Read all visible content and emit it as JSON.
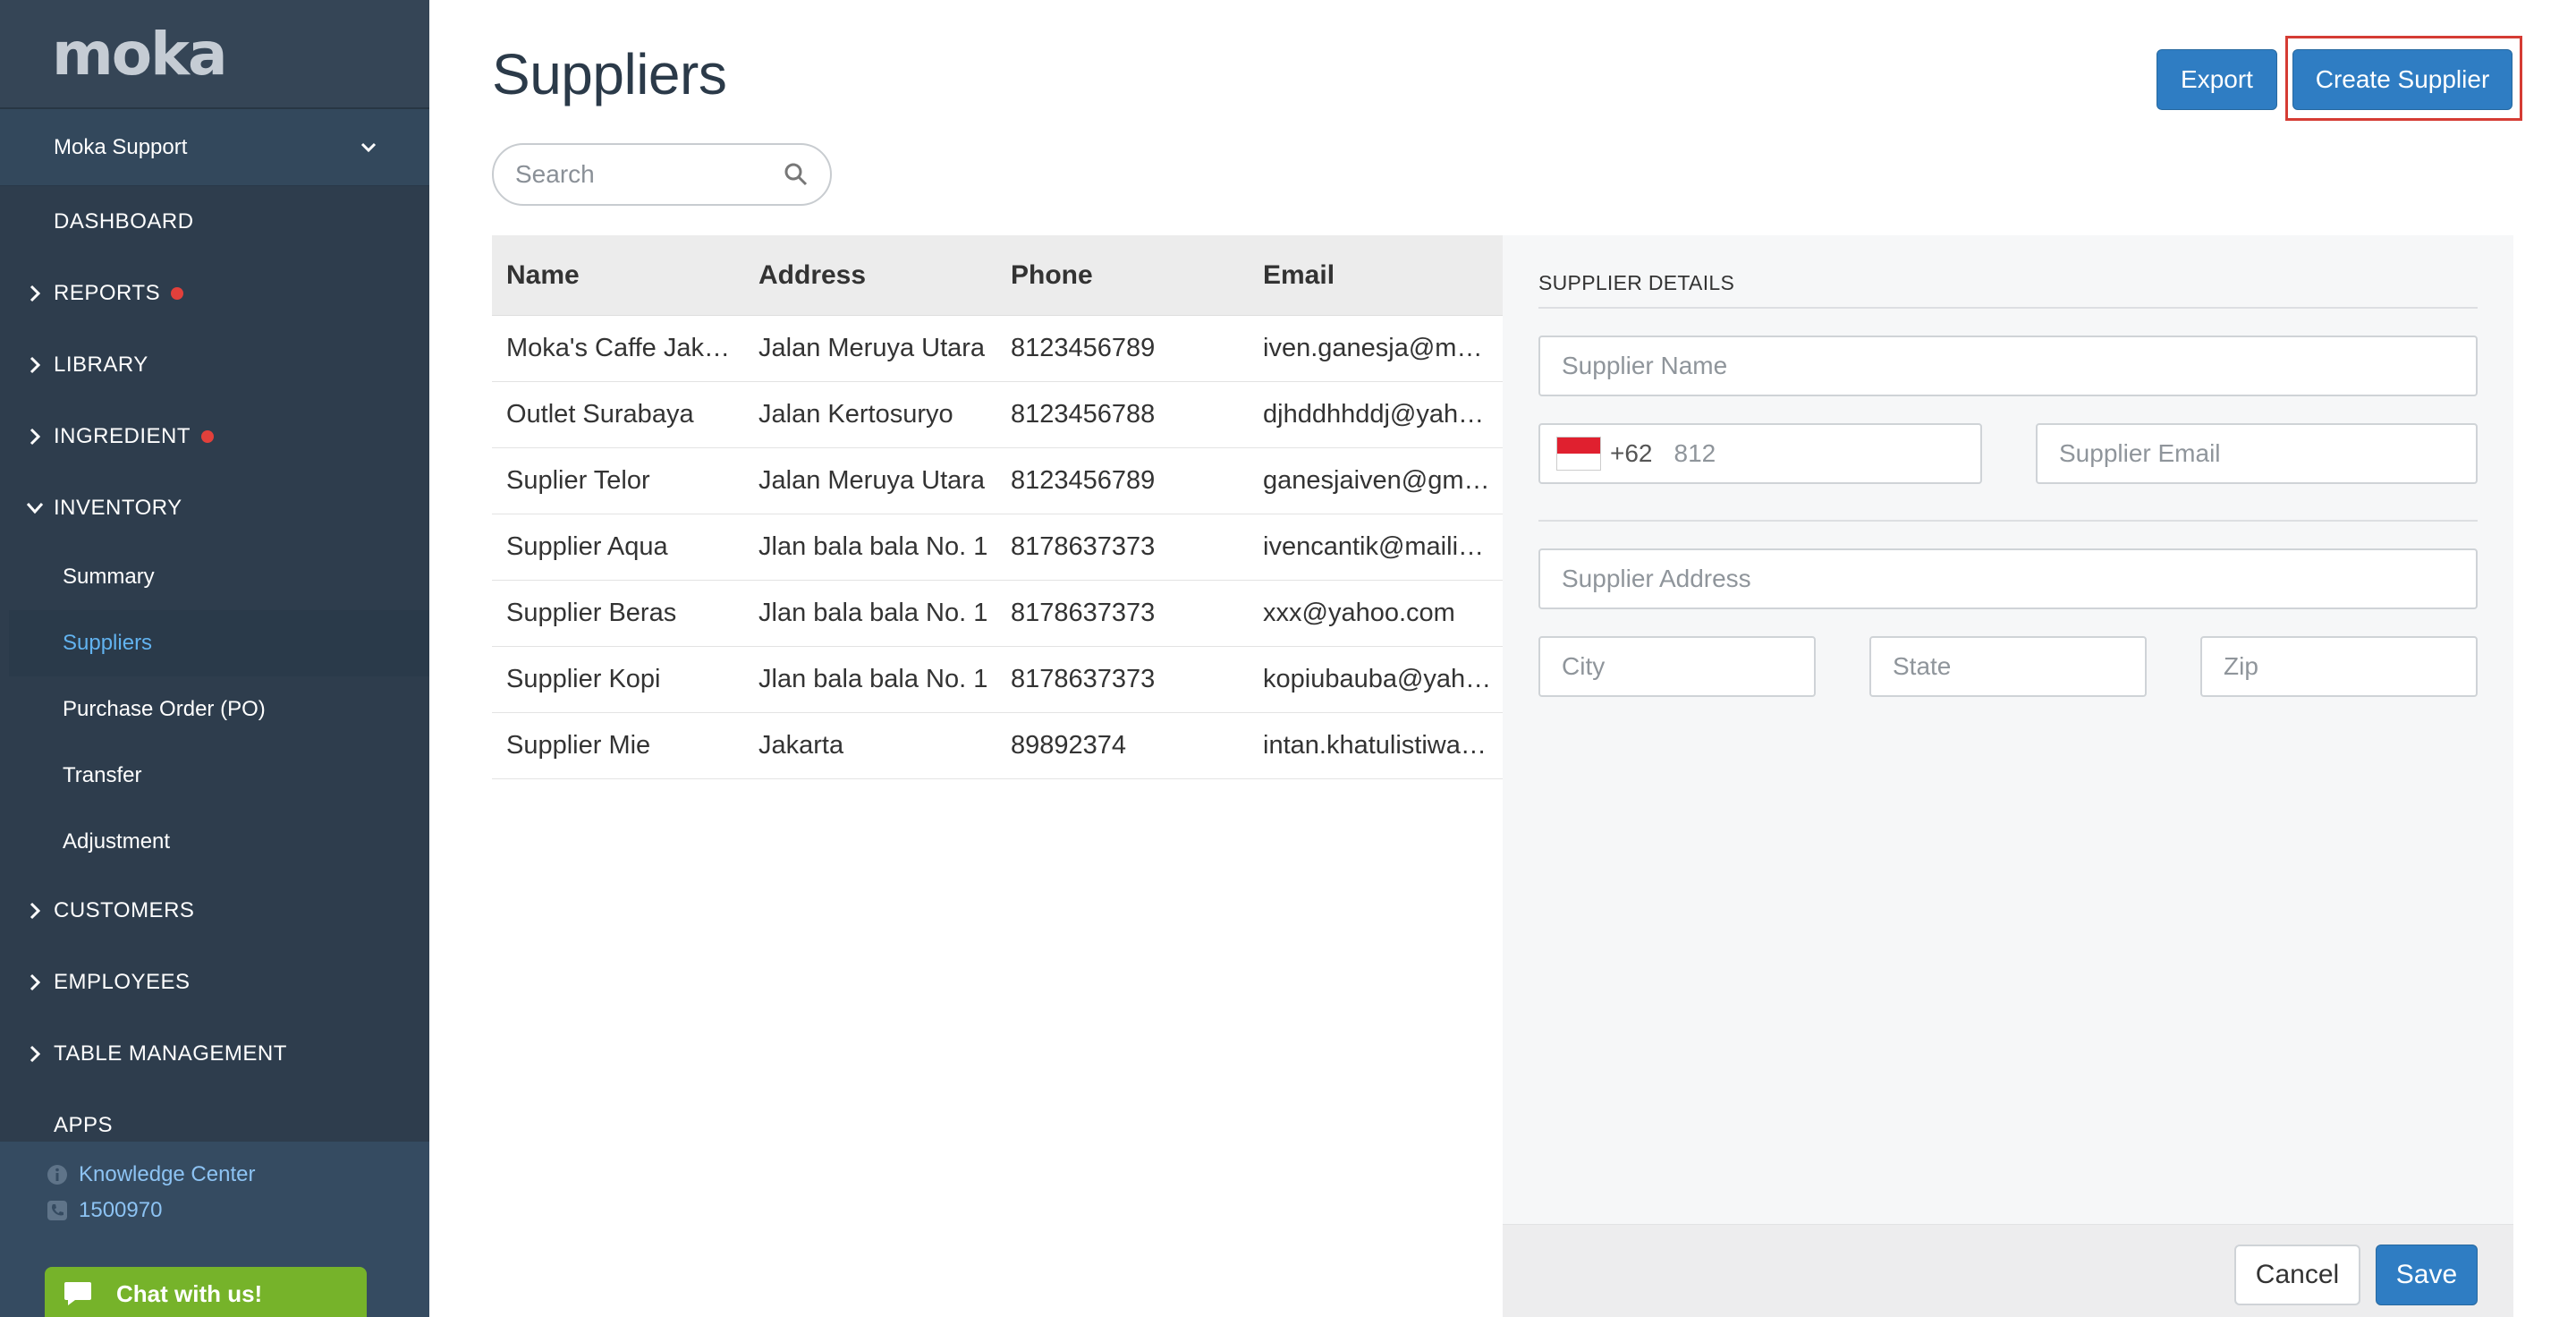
{
  "sidebar": {
    "logo": "moka",
    "account": "Moka Support",
    "nav": {
      "dashboard": "DASHBOARD",
      "reports": "REPORTS",
      "library": "LIBRARY",
      "ingredient": "INGREDIENT",
      "inventory": "INVENTORY",
      "customers": "CUSTOMERS",
      "employees": "EMPLOYEES",
      "table_management": "TABLE MANAGEMENT",
      "apps": "APPS"
    },
    "inventory_sub": {
      "summary": "Summary",
      "suppliers": "Suppliers",
      "purchase_order": "Purchase Order (PO)",
      "transfer": "Transfer",
      "adjustment": "Adjustment"
    },
    "knowledge_center": "Knowledge Center",
    "phone": "1500970",
    "chat": "Chat with us!"
  },
  "header": {
    "title": "Suppliers",
    "export_label": "Export",
    "create_label": "Create Supplier"
  },
  "search": {
    "placeholder": "Search"
  },
  "table": {
    "columns": {
      "name": "Name",
      "address": "Address",
      "phone": "Phone",
      "email": "Email"
    },
    "rows": [
      {
        "name": "Moka's Caffe Jakarta",
        "address": "Jalan Meruya Utara",
        "phone": "8123456789",
        "email": "iven.ganesja@moka.com"
      },
      {
        "name": "Outlet Surabaya",
        "address": "Jalan Kertosuryo",
        "phone": "8123456788",
        "email": "djhddhhddj@yahoo.com"
      },
      {
        "name": "Suplier Telor",
        "address": "Jalan Meruya Utara",
        "phone": "8123456789",
        "email": "ganesjaiven@gmail.com"
      },
      {
        "name": "Supplier Aqua",
        "address": "Jlan bala bala No. 1",
        "phone": "8178637373",
        "email": "ivencantik@mailinator.com"
      },
      {
        "name": "Supplier Beras",
        "address": "Jlan bala bala No. 1",
        "phone": "8178637373",
        "email": "xxx@yahoo.com"
      },
      {
        "name": "Supplier Kopi",
        "address": "Jlan bala bala No. 1",
        "phone": "8178637373",
        "email": "kopiubauba@yahoo.com"
      },
      {
        "name": "Supplier Mie",
        "address": "Jakarta",
        "phone": "89892374",
        "email": "intan.khatulistiwa@moka.com"
      }
    ]
  },
  "details": {
    "title": "SUPPLIER DETAILS",
    "name_placeholder": "Supplier Name",
    "country_code": "+62",
    "phone_placeholder": "812",
    "email_placeholder": "Supplier Email",
    "address_placeholder": "Supplier Address",
    "city_placeholder": "City",
    "state_placeholder": "State",
    "zip_placeholder": "Zip",
    "cancel_label": "Cancel",
    "save_label": "Save"
  },
  "colors": {
    "accent": "#2f7dc3",
    "sidebar": "#2e3d4d",
    "alert_dot": "#e2403b",
    "chat": "#76b32a"
  }
}
